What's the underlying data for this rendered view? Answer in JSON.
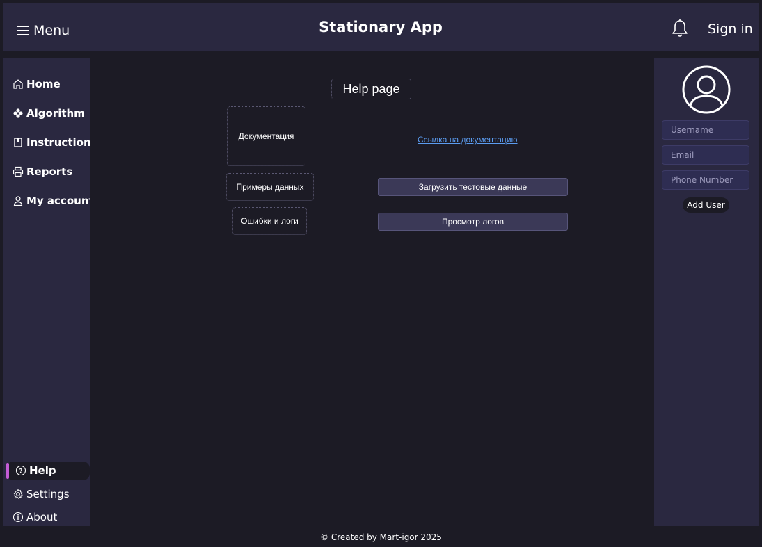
{
  "header": {
    "menu_label": "Menu",
    "app_title": "Stationary App",
    "sign_in_label": "Sign in"
  },
  "sidebar": {
    "items": [
      {
        "label": "Home",
        "icon": "home-icon"
      },
      {
        "label": "Algorithm",
        "icon": "flower-icon"
      },
      {
        "label": "Instructions",
        "icon": "book-icon"
      },
      {
        "label": "Reports",
        "icon": "printer-icon"
      },
      {
        "label": "My account",
        "icon": "person-icon"
      }
    ],
    "bottom_items": [
      {
        "label": "Help",
        "icon": "question-circle-icon",
        "active": true
      },
      {
        "label": "Settings",
        "icon": "gear-icon"
      },
      {
        "label": "About",
        "icon": "info-circle-icon"
      }
    ]
  },
  "main": {
    "page_title": "Help page",
    "documentation_label": "Документация",
    "documentation_link": "Ссылка на документацию",
    "examples_label": "Примеры данных",
    "load_test_data_button": "Загрузить тестовые данные",
    "errors_label": "Ошибки и логи",
    "view_logs_button": "Просмотр логов"
  },
  "user_panel": {
    "avatar_icon": "user-circle-icon",
    "username_placeholder": "Username",
    "email_placeholder": "Email",
    "phone_placeholder": "Phone Number",
    "add_user_label": "Add User"
  },
  "footer": {
    "text": "© Created by Mart-igor 2025"
  },
  "colors": {
    "background": "#1c1b25",
    "panel": "#2a2840",
    "accent": "#c45cd6",
    "link": "#5b9cf0"
  }
}
